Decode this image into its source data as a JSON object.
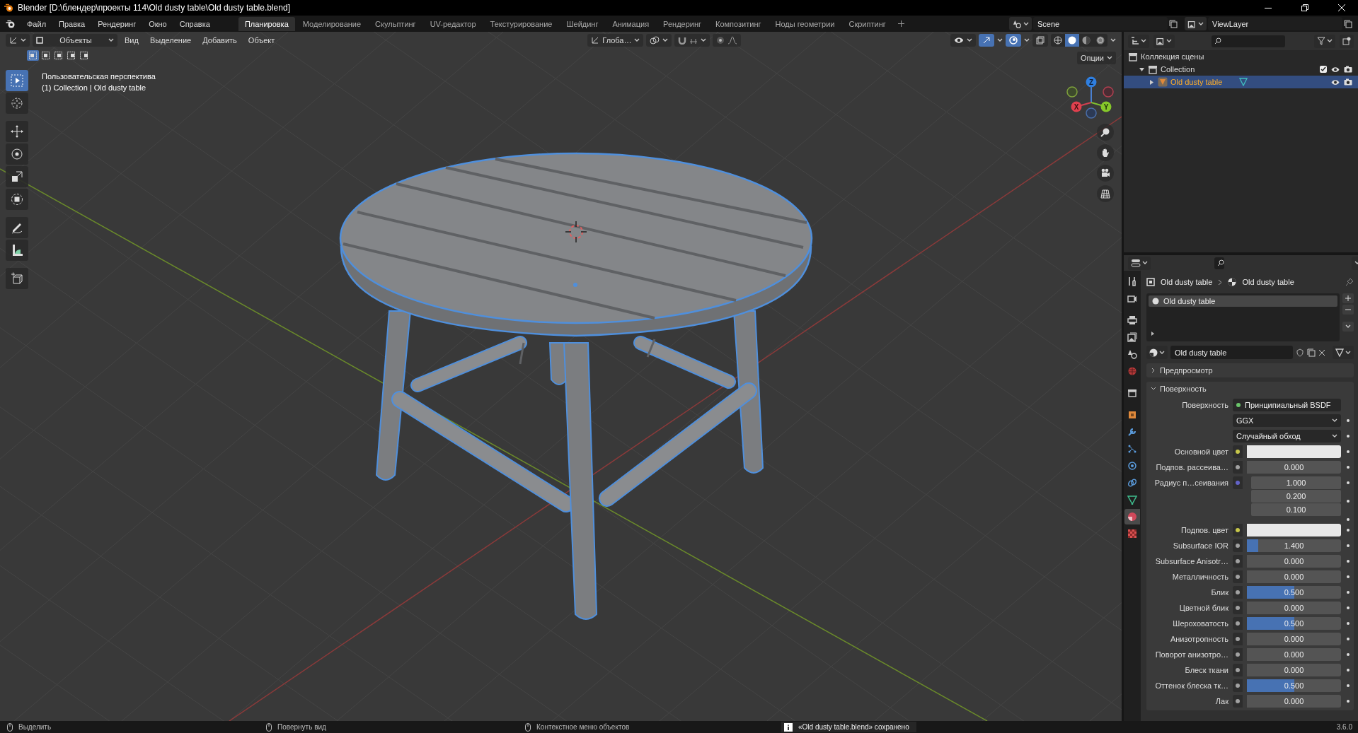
{
  "window": {
    "title": "Blender [D:\\блендер\\проекты 114\\Old dusty table\\Old dusty table.blend]"
  },
  "menu": [
    "Файл",
    "Правка",
    "Рендеринг",
    "Окно",
    "Справка"
  ],
  "workspaces": [
    {
      "label": "Планировка",
      "selected": true
    },
    {
      "label": "Моделирование",
      "selected": false
    },
    {
      "label": "Скульптинг",
      "selected": false
    },
    {
      "label": "UV-редактор",
      "selected": false
    },
    {
      "label": "Текстурирование",
      "selected": false
    },
    {
      "label": "Шейдинг",
      "selected": false
    },
    {
      "label": "Анимация",
      "selected": false
    },
    {
      "label": "Рендеринг",
      "selected": false
    },
    {
      "label": "Композитинг",
      "selected": false
    },
    {
      "label": "Ноды геометрии",
      "selected": false
    },
    {
      "label": "Скриптинг",
      "selected": false
    }
  ],
  "scene": "Scene",
  "view_layer": "ViewLayer",
  "viewport": {
    "mode": "Объекты",
    "menus": [
      "Вид",
      "Выделение",
      "Добавить",
      "Объект"
    ],
    "orientation": "Глоба…",
    "options": "Опции",
    "select_modes": [
      {
        "selected": true
      },
      {
        "selected": false
      },
      {
        "selected": false
      },
      {
        "selected": false
      },
      {
        "selected": false
      }
    ],
    "shading": [
      {
        "selected": false
      },
      {
        "selected": true
      },
      {
        "selected": false
      },
      {
        "selected": false
      }
    ],
    "overlay_lines": [
      "Пользовательская перспектива",
      "(1) Collection | Old dusty table"
    ],
    "gizmo": {
      "x": "X",
      "y": "Y",
      "z": "Z"
    },
    "tools": [
      {
        "kind": "select_box",
        "selected": true
      },
      {
        "kind": "cursor",
        "selected": false
      },
      {
        "kind": "move",
        "selected": false
      },
      {
        "kind": "rotate",
        "selected": false
      },
      {
        "kind": "scale",
        "selected": false
      },
      {
        "kind": "transform",
        "selected": false
      },
      {
        "kind": "annotate",
        "selected": false
      },
      {
        "kind": "measure",
        "selected": false
      },
      {
        "kind": "add_cube",
        "selected": false
      }
    ]
  },
  "outliner": {
    "items": [
      {
        "label": "Коллекция сцены",
        "kind": "scene_collection",
        "selected": false,
        "children": [
          {
            "label": "Collection",
            "kind": "collection",
            "selected": false,
            "expanded": true,
            "checked": true,
            "children": [
              {
                "label": "Old dusty table",
                "kind": "object",
                "selected": true,
                "expanded": false
              }
            ]
          }
        ]
      }
    ]
  },
  "properties": {
    "tabs": [
      {
        "kind": "tool",
        "selected": false
      },
      {
        "kind": "render",
        "selected": false
      },
      {
        "kind": "output",
        "selected": false
      },
      {
        "kind": "view_layer",
        "selected": false
      },
      {
        "kind": "scene",
        "selected": false
      },
      {
        "kind": "world",
        "selected": false
      },
      {
        "kind": "collection",
        "selected": false
      },
      {
        "kind": "object",
        "selected": false
      },
      {
        "kind": "modifier",
        "selected": false
      },
      {
        "kind": "particles",
        "selected": false
      },
      {
        "kind": "physics",
        "selected": false
      },
      {
        "kind": "constraints",
        "selected": false
      },
      {
        "kind": "data",
        "selected": false
      },
      {
        "kind": "material",
        "selected": true
      },
      {
        "kind": "texture",
        "selected": false
      }
    ],
    "breadcrumb": [
      "Old dusty table",
      "Old dusty table"
    ],
    "slots": [
      {
        "name": "Old dusty table",
        "selected": true
      }
    ],
    "material": "Old dusty table",
    "panels": [
      {
        "title": "Предпросмотр",
        "expanded": false
      },
      {
        "title": "Поверхность",
        "expanded": true
      }
    ],
    "rows": [
      {
        "kind": "shader",
        "label": "Поверхность",
        "value": "Принципиальный BSDF"
      },
      {
        "kind": "dropdown",
        "value": "GGX"
      },
      {
        "kind": "dropdown",
        "value": "Случайный обход"
      },
      {
        "kind": "color",
        "label": "Основной цвет",
        "color": "#e8e8e8"
      },
      {
        "kind": "number",
        "label": "Подпов. рассеива…",
        "value": "0.000"
      },
      {
        "kind": "vector",
        "label": "Радиус п…сеивания",
        "values": [
          "1.000",
          "0.200",
          "0.100"
        ]
      },
      {
        "kind": "color",
        "label": "Подпов. цвет",
        "color": "#e8e8e8"
      },
      {
        "kind": "number",
        "label": "Subsurface IOR",
        "value": "1.400",
        "level": 0.12
      },
      {
        "kind": "number",
        "label": "Subsurface Anisotr…",
        "value": "0.000"
      },
      {
        "kind": "number",
        "label": "Металличность",
        "value": "0.000"
      },
      {
        "kind": "number",
        "label": "Блик",
        "value": "0.500",
        "level": 0.5
      },
      {
        "kind": "number",
        "label": "Цветной блик",
        "value": "0.000"
      },
      {
        "kind": "number",
        "label": "Шероховатость",
        "value": "0.500",
        "level": 0.5
      },
      {
        "kind": "number",
        "label": "Анизотропность",
        "value": "0.000"
      },
      {
        "kind": "number",
        "label": "Поворот анизотро…",
        "value": "0.000"
      },
      {
        "kind": "number",
        "label": "Блеск ткани",
        "value": "0.000"
      },
      {
        "kind": "number",
        "label": "Оттенок блеска тк…",
        "value": "0.500",
        "level": 0.5
      },
      {
        "kind": "number",
        "label": "Лак",
        "value": "0.000"
      }
    ]
  },
  "version": "3.6.0",
  "status": {
    "hints": [
      "Выделить",
      "Повернуть вид",
      "Контекстное меню объектов"
    ],
    "message": "«Old dusty table.blend» сохранено"
  }
}
